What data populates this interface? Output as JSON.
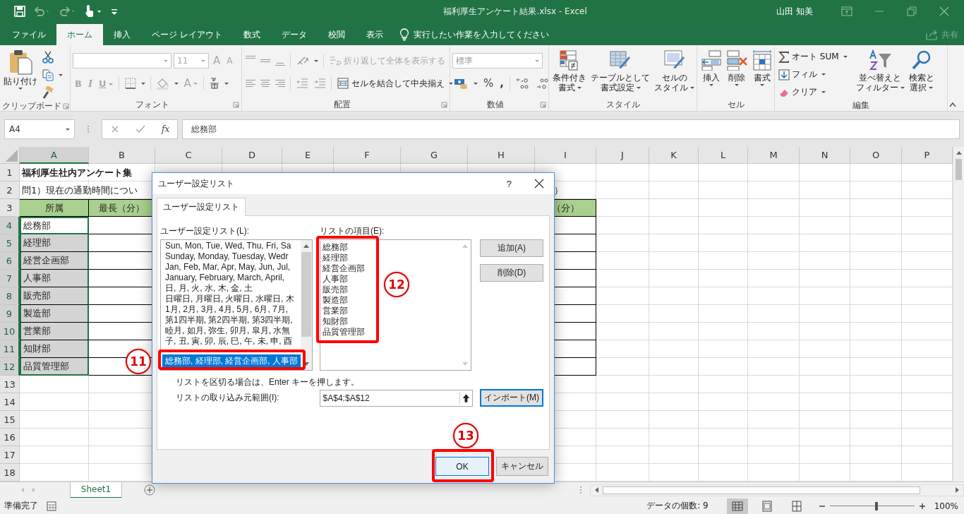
{
  "window": {
    "title": "福利厚生アンケート結果.xlsx  -  Excel",
    "user": "山田 知美"
  },
  "menu_tabs": [
    {
      "label": "ファイル",
      "selected": false
    },
    {
      "label": "ホーム",
      "selected": true
    },
    {
      "label": "挿入",
      "selected": false
    },
    {
      "label": "ページ レイアウト",
      "selected": false
    },
    {
      "label": "数式",
      "selected": false
    },
    {
      "label": "データ",
      "selected": false
    },
    {
      "label": "校閲",
      "selected": false
    },
    {
      "label": "表示",
      "selected": false
    }
  ],
  "tell_me": {
    "placeholder": "実行したい作業を入力してください"
  },
  "share": "共有",
  "ribbon": {
    "groups": [
      {
        "kind": "clipboard",
        "label": "クリップボード",
        "paste": "貼り付け"
      },
      {
        "kind": "font",
        "label": "フォント",
        "size": "11",
        "grow": "A",
        "shrink": "A",
        "format_buttons": [
          {
            "label": "B"
          },
          {
            "label": "I"
          },
          {
            "label": "U"
          }
        ],
        "font_color": "A"
      },
      {
        "kind": "alignment",
        "label": "配置",
        "wrap": {
          "label": "折り返して全体を表示する",
          "disabled": true
        },
        "merge": {
          "label": "セルを結合して中央揃え",
          "disabled": false
        }
      },
      {
        "kind": "number",
        "label": "数値",
        "format": "標準",
        "percent": "%",
        "comma": ","
      },
      {
        "kind": "styles",
        "label": "スタイル",
        "buttons": [
          {
            "lines": [
              "条件付き",
              "書式"
            ]
          },
          {
            "lines": [
              "テーブルとして",
              "書式設定"
            ]
          },
          {
            "lines": [
              "セルの",
              "スタイル"
            ]
          }
        ]
      },
      {
        "kind": "cells",
        "label": "セル",
        "buttons": [
          {
            "lines": [
              "挿入"
            ]
          },
          {
            "lines": [
              "削除"
            ]
          },
          {
            "lines": [
              "書式"
            ]
          }
        ]
      },
      {
        "kind": "editing",
        "label": "編集",
        "small": [
          {
            "label": "オート SUM"
          },
          {
            "label": "フィル"
          },
          {
            "label": "クリア"
          }
        ],
        "buttons": [
          {
            "lines": [
              "並べ替えと",
              "フィルター"
            ]
          },
          {
            "lines": [
              "検索と",
              "選択"
            ]
          }
        ]
      }
    ]
  },
  "formula_bar": {
    "name_box": "A4",
    "fx": "fx",
    "value": "総務部"
  },
  "sheet": {
    "columns": [
      {
        "label": "A",
        "selected": true
      },
      {
        "label": "B",
        "selected": false
      },
      {
        "label": "C",
        "selected": false
      },
      {
        "label": "D",
        "selected": false
      },
      {
        "label": "E",
        "selected": false
      },
      {
        "label": "F",
        "selected": false
      },
      {
        "label": "G",
        "selected": false
      },
      {
        "label": "H",
        "selected": false
      },
      {
        "label": "I",
        "selected": false
      },
      {
        "label": "J",
        "selected": false
      },
      {
        "label": "K",
        "selected": false
      },
      {
        "label": "L",
        "selected": false
      },
      {
        "label": "M",
        "selected": false
      },
      {
        "label": "N",
        "selected": false
      },
      {
        "label": "O",
        "selected": false
      },
      {
        "label": "P",
        "selected": false
      }
    ],
    "rows": [
      {
        "label": "1",
        "selected": false,
        "kind": "title",
        "cells": [
          "福利厚生社内アンケート集"
        ]
      },
      {
        "label": "2",
        "selected": false,
        "kind": "note",
        "cells": [
          "問1）現在の通勤時間につい",
          "",
          "",
          "",
          "",
          "",
          "",
          "",
          "）"
        ]
      },
      {
        "label": "3",
        "selected": false,
        "kind": "header",
        "cells": [
          "所属",
          "最長（分）",
          "",
          "",
          "",
          "",
          "",
          "",
          "（分）"
        ]
      },
      {
        "label": "4",
        "selected": true,
        "kind": "data",
        "cells": [
          "総務部"
        ]
      },
      {
        "label": "5",
        "selected": true,
        "kind": "data",
        "cells": [
          "経理部"
        ]
      },
      {
        "label": "6",
        "selected": true,
        "kind": "data",
        "cells": [
          "経営企画部"
        ]
      },
      {
        "label": "7",
        "selected": true,
        "kind": "data",
        "cells": [
          "人事部"
        ]
      },
      {
        "label": "8",
        "selected": true,
        "kind": "data",
        "cells": [
          "販売部"
        ]
      },
      {
        "label": "9",
        "selected": true,
        "kind": "data",
        "cells": [
          "製造部"
        ]
      },
      {
        "label": "10",
        "selected": true,
        "kind": "data",
        "cells": [
          "営業部"
        ]
      },
      {
        "label": "11",
        "selected": true,
        "kind": "data",
        "cells": [
          "知財部"
        ]
      },
      {
        "label": "12",
        "selected": true,
        "kind": "data",
        "cells": [
          "品質管理部"
        ]
      },
      {
        "label": "13",
        "selected": false,
        "kind": "plain",
        "cells": []
      },
      {
        "label": "14",
        "selected": false,
        "kind": "plain",
        "cells": []
      },
      {
        "label": "15",
        "selected": false,
        "kind": "plain",
        "cells": []
      },
      {
        "label": "16",
        "selected": false,
        "kind": "plain",
        "cells": []
      },
      {
        "label": "17",
        "selected": false,
        "kind": "plain",
        "cells": []
      },
      {
        "label": "18",
        "selected": false,
        "kind": "plain",
        "cells": []
      }
    ]
  },
  "sheet_tabs": [
    {
      "label": "Sheet1",
      "selected": true
    }
  ],
  "status_bar": {
    "mode": "準備完了",
    "count": "データの個数: 9",
    "zoom": "100%",
    "zoom_slider": {
      "level": 0.55
    }
  },
  "dialog": {
    "title": "ユーザー設定リスト",
    "help": "?",
    "tab": {
      "label": "ユーザー設定リスト",
      "selected": true
    },
    "lists_label": "ユーザー設定リスト(L):",
    "lists": [
      {
        "text": "Sun, Mon, Tue, Wed, Thu, Fri, Sa",
        "selected": false
      },
      {
        "text": "Sunday, Monday, Tuesday, Wedr",
        "selected": false
      },
      {
        "text": "Jan, Feb, Mar, Apr, May, Jun, Jul,",
        "selected": false
      },
      {
        "text": "January, February, March, April,",
        "selected": false
      },
      {
        "text": "日, 月, 火, 水, 木, 金, 土",
        "selected": false
      },
      {
        "text": "日曜日, 月曜日, 火曜日, 水曜日, 木",
        "selected": false
      },
      {
        "text": "1月, 2月, 3月, 4月, 5月, 6月, 7月,",
        "selected": false
      },
      {
        "text": "第1四半期, 第2四半期, 第3四半期,",
        "selected": false
      },
      {
        "text": "睦月, 如月, 弥生, 卯月, 皐月, 水無",
        "selected": false
      },
      {
        "text": "子, 丑, 寅, 卯, 辰, 巳, 午, 未, 申, 酉",
        "selected": false
      },
      {
        "text": "総務部, 経理部, 経営企画部, 人事部",
        "selected": true
      }
    ],
    "entries_label": "リストの項目(E):",
    "entries": [
      "総務部",
      "経理部",
      "経営企画部",
      "人事部",
      "販売部",
      "製造部",
      "営業部",
      "知財部",
      "品質管理部"
    ],
    "add_button": "追加(A)",
    "delete_button": "削除(D)",
    "hint": "リストを区切る場合は、Enter キーを押します。",
    "range_label": "リストの取り込み元範囲(I):",
    "range_value": "$A$4:$A$12",
    "import_button": "インポート(M)",
    "ok_button": "OK",
    "cancel_button": "キャンセル"
  },
  "annotations": [
    {
      "label": "11"
    },
    {
      "label": "12"
    },
    {
      "label": "13"
    }
  ]
}
